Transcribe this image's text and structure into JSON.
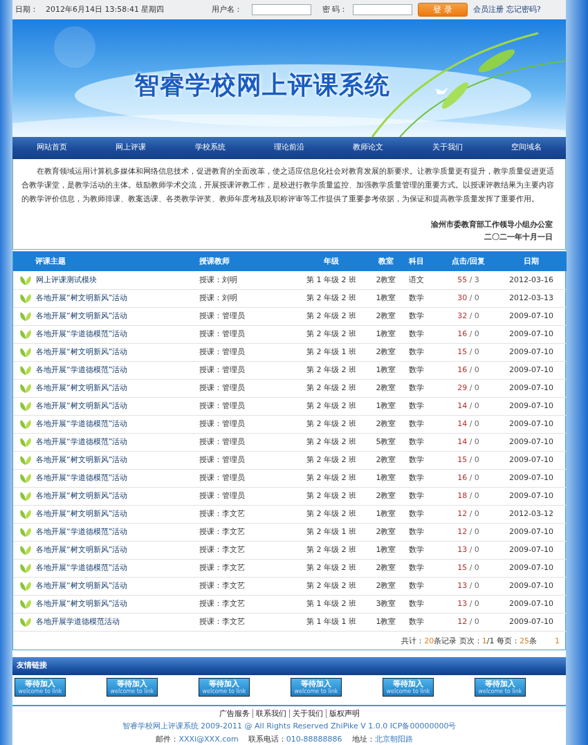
{
  "top_bar": {
    "date_label": "日期：",
    "date_value": "2012年6月14日  13:58:41 星期四",
    "username_label": "用户名：",
    "password_label": "密  码：",
    "login_button": "登 录",
    "links": [
      "会员注册",
      "忘记密码?"
    ]
  },
  "banner": {
    "title": "智睿学校网上评课系统"
  },
  "nav": [
    {
      "label": "网站首页",
      "selected": false
    },
    {
      "label": "网上评课",
      "selected": false
    },
    {
      "label": "学校系统",
      "selected": false
    },
    {
      "label": "理论前沿",
      "selected": false
    },
    {
      "label": "教师论文",
      "selected": false
    },
    {
      "label": "关于我们",
      "selected": false
    },
    {
      "label": "空间域名",
      "selected": false
    }
  ],
  "intro": {
    "text": "在教育领域运用计算机多媒体和网络信息技术，促进教育的全面改革，使之适应信息化社会对教育发展的新要求。让教学质量更有提升，教学质量促进更适合教学课堂，是教学活动的主体。鼓励教师学术交流，开展授课评教工作，是校进行教学质量监控、加强教学质量管理的重要方式。以授课评教结果为主要内容的教学评价信息，为教师排课、教案选课、各类教学评奖、教师年度考核及职称评审等工作提供了重要参考依据，为保证和提高教学质量发挥了重要作用。",
    "signature": "渝州市委教育部工作领导小组办公室",
    "date": "二〇二一年十月一日"
  },
  "table": {
    "columns": [
      "评课主题",
      "授课教师",
      "年级",
      "教室",
      "科目",
      "点击/回复",
      "日期"
    ],
    "rows": [
      {
        "topic": "网上评课测试模块",
        "teacher": "授课：刘明",
        "grade": "第 1 年级 2 班",
        "room": "2教室",
        "subject": "语文",
        "clicks": "55",
        "replies": "/ 3",
        "date": "2012-03-16"
      },
      {
        "topic": "各地开展“树文明新风”活动",
        "teacher": "授课：刘明",
        "grade": "第 2 年级 2 班",
        "room": "1教室",
        "subject": "数学",
        "clicks": "30",
        "replies": "/ 0",
        "date": "2012-03-13"
      },
      {
        "topic": "各地开展“树文明新风”活动",
        "teacher": "授课：管理员",
        "grade": "第 2 年级 2 班",
        "room": "2教室",
        "subject": "数学",
        "clicks": "32",
        "replies": "/ 0",
        "date": "2009-07-10"
      },
      {
        "topic": "各地开展“学道德模范”活动",
        "teacher": "授课：管理员",
        "grade": "第 2 年级 2 班",
        "room": "1教室",
        "subject": "数学",
        "clicks": "16",
        "replies": "/ 0",
        "date": "2009-07-10"
      },
      {
        "topic": "各地开展“树文明新风”活动",
        "teacher": "授课：管理员",
        "grade": "第 2 年级 1 班",
        "room": "2教室",
        "subject": "数学",
        "clicks": "15",
        "replies": "/ 0",
        "date": "2009-07-10"
      },
      {
        "topic": "各地开展“学道德模范”活动",
        "teacher": "授课：管理员",
        "grade": "第 2 年级 2 班",
        "room": "1教室",
        "subject": "数学",
        "clicks": "16",
        "replies": "/ 0",
        "date": "2009-07-10"
      },
      {
        "topic": "各地开展“树文明新风”活动",
        "teacher": "授课：管理员",
        "grade": "第 2 年级 2 班",
        "room": "2教室",
        "subject": "数学",
        "clicks": "29",
        "replies": "/ 0",
        "date": "2009-07-10"
      },
      {
        "topic": "各地开展“树文明新风”活动",
        "teacher": "授课：管理员",
        "grade": "第 2 年级 2 班",
        "room": "1教室",
        "subject": "数学",
        "clicks": "14",
        "replies": "/ 0",
        "date": "2009-07-10"
      },
      {
        "topic": "各地开展“学道德模范”活动",
        "teacher": "授课：管理员",
        "grade": "第 2 年级 2 班",
        "room": "2教室",
        "subject": "数学",
        "clicks": "14",
        "replies": "/ 0",
        "date": "2009-07-10"
      },
      {
        "topic": "各地开展“学道德模范”活动",
        "teacher": "授课：管理员",
        "grade": "第 2 年级 2 班",
        "room": "5教室",
        "subject": "数学",
        "clicks": "14",
        "replies": "/ 0",
        "date": "2009-07-10"
      },
      {
        "topic": "各地开展“树文明新风”活动",
        "teacher": "授课：管理员",
        "grade": "第 2 年级 2 班",
        "room": "2教室",
        "subject": "数学",
        "clicks": "15",
        "replies": "/ 0",
        "date": "2009-07-10"
      },
      {
        "topic": "各地开展“学道德模范”活动",
        "teacher": "授课：管理员",
        "grade": "第 2 年级 2 班",
        "room": "1教室",
        "subject": "数学",
        "clicks": "16",
        "replies": "/ 0",
        "date": "2009-07-10"
      },
      {
        "topic": "各地开展“树文明新风”活动",
        "teacher": "授课：管理员",
        "grade": "第 2 年级 2 班",
        "room": "2教室",
        "subject": "数学",
        "clicks": "18",
        "replies": "/ 0",
        "date": "2009-07-10"
      },
      {
        "topic": "各地开展“树文明新风”活动",
        "teacher": "授课：李文艺",
        "grade": "第 2 年级 2 班",
        "room": "1教室",
        "subject": "数学",
        "clicks": "12",
        "replies": "/ 0",
        "date": "2012-03-12"
      },
      {
        "topic": "各地开展“学道德模范”活动",
        "teacher": "授课：李文艺",
        "grade": "第 2 年级 1 班",
        "room": "2教室",
        "subject": "数学",
        "clicks": "12",
        "replies": "/ 0",
        "date": "2009-07-10"
      },
      {
        "topic": "各地开展“树文明新风”活动",
        "teacher": "授课：李文艺",
        "grade": "第 2 年级 2 班",
        "room": "1教室",
        "subject": "数学",
        "clicks": "13",
        "replies": "/ 0",
        "date": "2009-07-10"
      },
      {
        "topic": "各地开展“学道德模范”活动",
        "teacher": "授课：李文艺",
        "grade": "第 2 年级 2 班",
        "room": "2教室",
        "subject": "数学",
        "clicks": "15",
        "replies": "/ 0",
        "date": "2009-07-10"
      },
      {
        "topic": "各地开展“树文明新风”活动",
        "teacher": "授课：李文艺",
        "grade": "第 2 年级 2 班",
        "room": "2教室",
        "subject": "数学",
        "clicks": "13",
        "replies": "/ 0",
        "date": "2009-07-10"
      },
      {
        "topic": "各地开展“树文明新风”活动",
        "teacher": "授课：李文艺",
        "grade": "第 1 年级 2 班",
        "room": "3教室",
        "subject": "数学",
        "clicks": "13",
        "replies": "/ 0",
        "date": "2009-07-10"
      },
      {
        "topic": "各地开展学道德模范活动",
        "teacher": "授课：李文艺",
        "grade": "第 1 年级 1 班",
        "room": "1教室",
        "subject": "数学",
        "clicks": "12",
        "replies": "/ 0",
        "date": "2009-07-10"
      }
    ],
    "pager": {
      "parts": [
        {
          "text": "共计：",
          "highlight": false
        },
        {
          "text": "20",
          "highlight": true
        },
        {
          "text": "条记录 页次：",
          "highlight": false
        },
        {
          "text": "1",
          "highlight": true
        },
        {
          "text": "/1 每页：",
          "highlight": false
        },
        {
          "text": "25",
          "highlight": true
        },
        {
          "text": "条",
          "highlight": false
        }
      ],
      "page_link": "1"
    }
  },
  "friend_links": {
    "title": "友情链接",
    "badges": [
      {
        "main": "等待加入",
        "sub": "welcome to link"
      },
      {
        "main": "等待加入",
        "sub": "welcome to link"
      },
      {
        "main": "等待加入",
        "sub": "welcome to link"
      },
      {
        "main": "等待加入",
        "sub": "welcome to link"
      },
      {
        "main": "等待加入",
        "sub": "welcome to link"
      },
      {
        "main": "等待加入",
        "sub": "welcome to link"
      }
    ]
  },
  "footer": {
    "links": [
      "广告服务",
      "联系我们",
      "关于我们",
      "版权声明"
    ],
    "copyright": "智睿学校网上评课系统  2009-2011 @ All Rights Reserved ZhiPike V 1.0.0 ICP备00000000号",
    "contacts": [
      {
        "label": "邮件：",
        "value": "XXXi@XXX.com"
      },
      {
        "label": "联系电话：",
        "value": "010-88888886"
      },
      {
        "label": "地址：",
        "value": "北京朝阳路"
      }
    ]
  }
}
